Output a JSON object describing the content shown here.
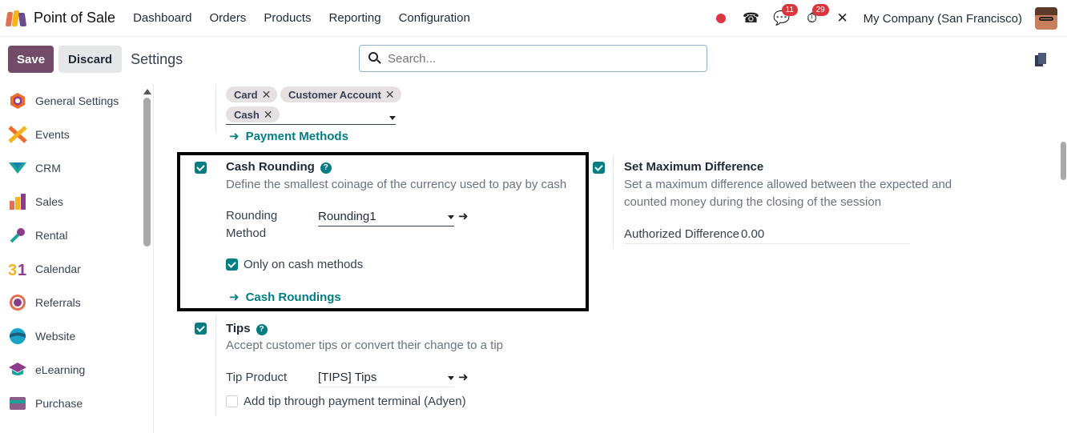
{
  "topbar": {
    "app_name": "Point of Sale",
    "nav": [
      "Dashboard",
      "Orders",
      "Products",
      "Reporting",
      "Configuration"
    ],
    "messages_count": "11",
    "activities_count": "29",
    "company": "My Company (San Francisco)"
  },
  "controlbar": {
    "save_label": "Save",
    "discard_label": "Discard",
    "title": "Settings",
    "search_placeholder": "Search..."
  },
  "sidebar": {
    "items": [
      {
        "label": "General Settings",
        "icon": "general-settings-icon",
        "color": "#f06a2c"
      },
      {
        "label": "Events",
        "icon": "events-icon",
        "color": "#f06a2c"
      },
      {
        "label": "CRM",
        "icon": "crm-icon",
        "color": "#1aa39a"
      },
      {
        "label": "Sales",
        "icon": "sales-icon",
        "color": "#e46f4f"
      },
      {
        "label": "Rental",
        "icon": "rental-icon",
        "color": "#1aa39a"
      },
      {
        "label": "Calendar",
        "icon": "calendar-icon",
        "color": "#f5b31c"
      },
      {
        "label": "Referrals",
        "icon": "referrals-icon",
        "color": "#e46f4f"
      },
      {
        "label": "Website",
        "icon": "website-icon",
        "color": "#1aa3c9"
      },
      {
        "label": "eLearning",
        "icon": "elearning-icon",
        "color": "#1aa39a"
      },
      {
        "label": "Purchase",
        "icon": "purchase-icon",
        "color": "#8c5c8a"
      }
    ]
  },
  "payment": {
    "tags": [
      "Card",
      "Customer Account",
      "Cash"
    ],
    "link": "Payment Methods"
  },
  "cash_rounding": {
    "title": "Cash Rounding",
    "description": "Define the smallest coinage of the currency used to pay by cash",
    "method_label_1": "Rounding",
    "method_label_2": "Method",
    "method_value": "Rounding1",
    "only_cash_label": "Only on cash methods",
    "link": "Cash Roundings"
  },
  "max_diff": {
    "title": "Set Maximum Difference",
    "description_1": "Set a maximum difference allowed between the expected and",
    "description_2": "counted money during the closing of the session",
    "authorized_label": "Authorized Difference",
    "authorized_value": "0.00"
  },
  "tips": {
    "title": "Tips",
    "description": "Accept customer tips or convert their change to a tip",
    "product_label": "Tip Product",
    "product_value": "[TIPS] Tips",
    "terminal_label": "Add tip through payment terminal (Adyen)"
  },
  "colors": {
    "accent": "#017e84",
    "primary_button": "#714b67",
    "badge": "#d9363e"
  }
}
